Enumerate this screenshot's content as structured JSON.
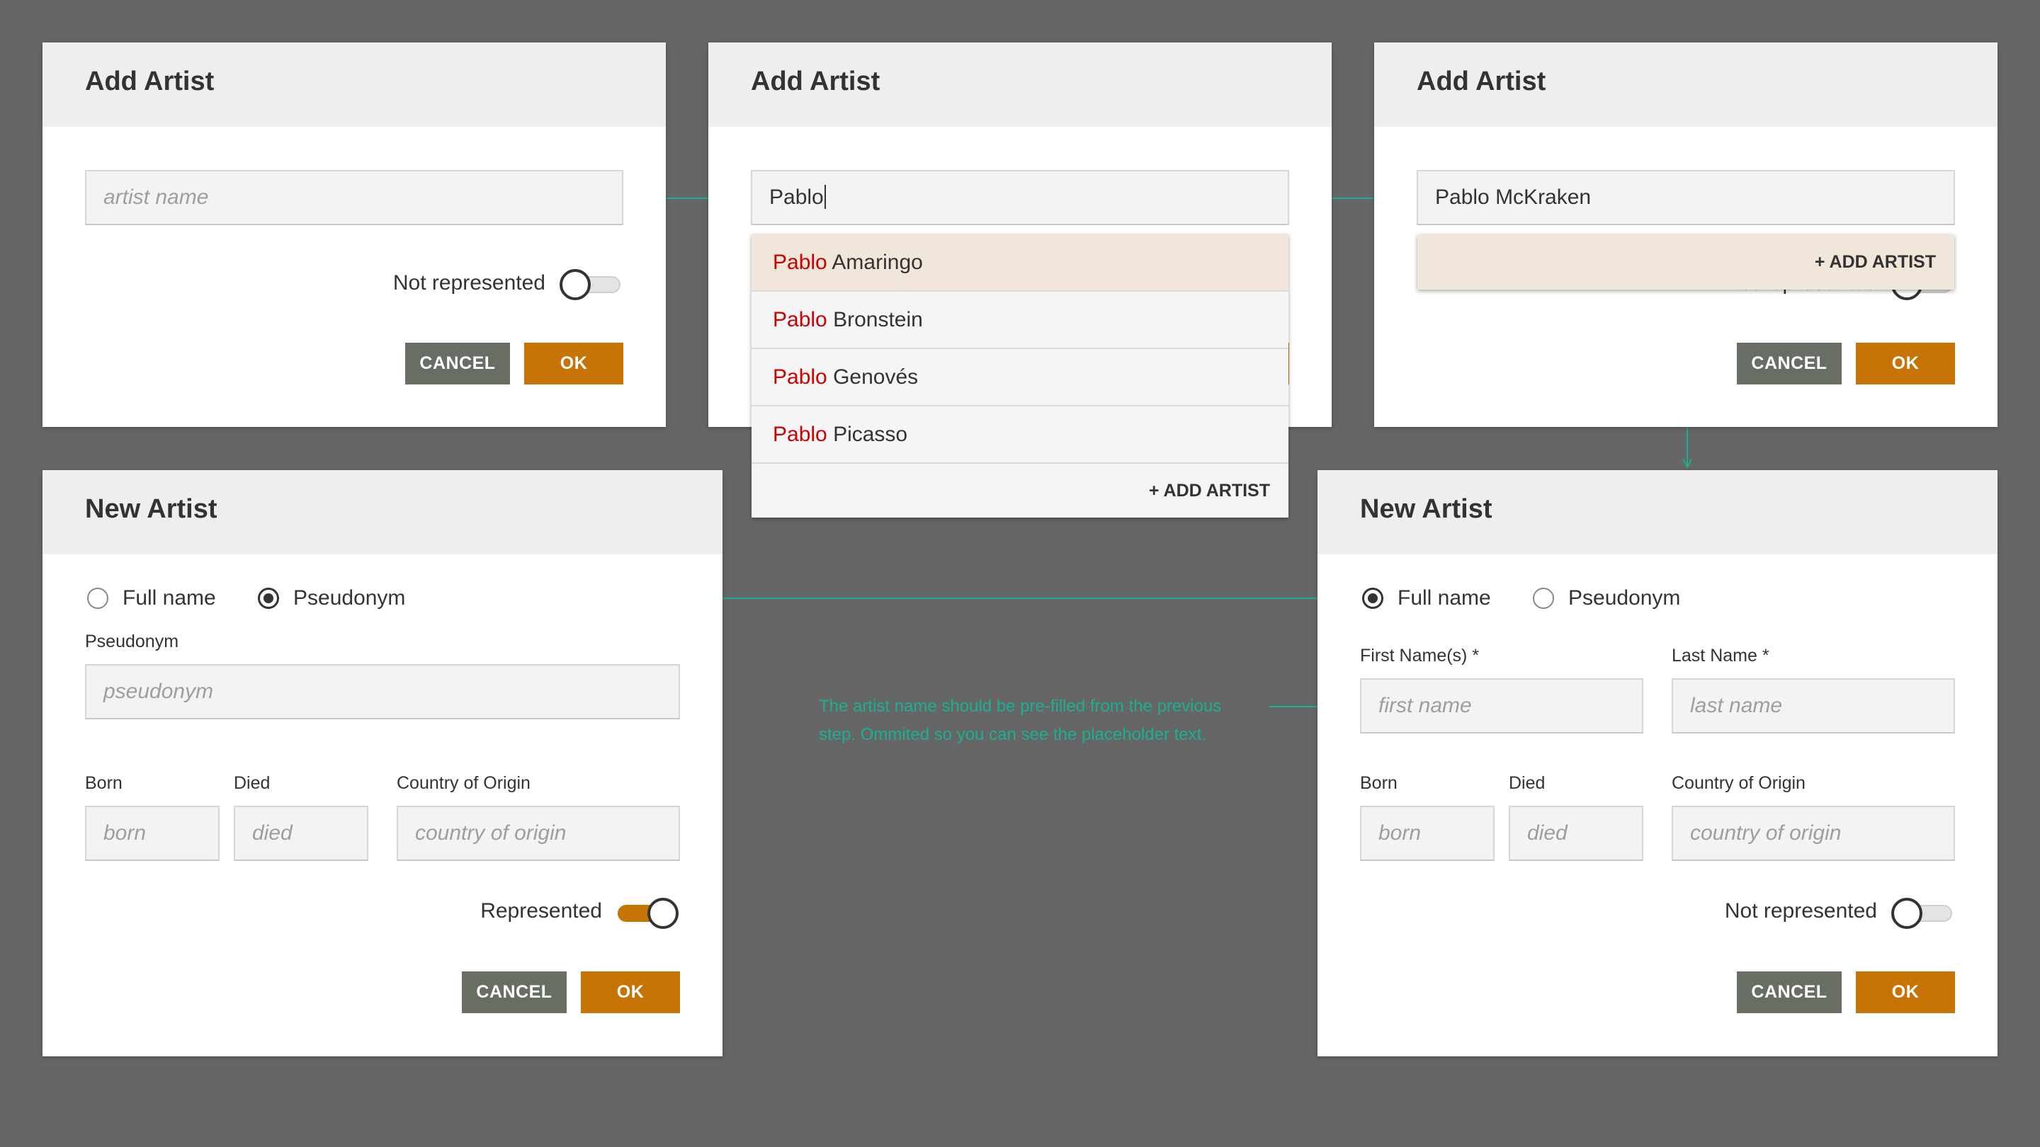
{
  "colors": {
    "background": "#666666",
    "accent": "#c77406",
    "cancel": "#686e63",
    "arrow": "#1aaf93",
    "match": "#cc0000",
    "highlight": "#f0e6da"
  },
  "panel1": {
    "title": "Add Artist",
    "artist_placeholder": "artist name",
    "toggle_label": "Not represented",
    "toggle_on": false,
    "cancel": "CANCEL",
    "ok": "OK"
  },
  "panel2": {
    "title": "Add Artist",
    "artist_value": "Pablo",
    "results": [
      {
        "match": "Pablo",
        "rest": " Amaringo",
        "highlighted": true
      },
      {
        "match": "Pablo",
        "rest": " Bronstein",
        "highlighted": false
      },
      {
        "match": "Pablo",
        "rest": " Genovés",
        "highlighted": false
      },
      {
        "match": "Pablo",
        "rest": " Picasso",
        "highlighted": false
      }
    ],
    "add_artist": "+ ADD ARTIST"
  },
  "panel3": {
    "title": "Add Artist",
    "artist_value": "Pablo McKraken",
    "add_artist": "+ ADD ARTIST",
    "toggle_label_partial": "Not represented",
    "cancel": "CANCEL",
    "ok": "OK"
  },
  "panel4": {
    "title": "New Artist",
    "radio_full": "Full name",
    "radio_pseudo": "Pseudonym",
    "selected": "Pseudonym",
    "pseudonym_label": "Pseudonym",
    "pseudonym_placeholder": "pseudonym",
    "born_label": "Born",
    "born_placeholder": "born",
    "died_label": "Died",
    "died_placeholder": "died",
    "country_label": "Country of Origin",
    "country_placeholder": "country of origin",
    "toggle_label": "Represented",
    "toggle_on": true,
    "cancel": "CANCEL",
    "ok": "OK"
  },
  "panel5": {
    "title": "New Artist",
    "radio_full": "Full name",
    "radio_pseudo": "Pseudonym",
    "selected": "Full name",
    "first_label": "First Name(s) *",
    "first_placeholder": "first name",
    "last_label": "Last Name *",
    "last_placeholder": "last name",
    "born_label": "Born",
    "born_placeholder": "born",
    "died_label": "Died",
    "died_placeholder": "died",
    "country_label": "Country of Origin",
    "country_placeholder": "country of origin",
    "toggle_label": "Not represented",
    "toggle_on": false,
    "cancel": "CANCEL",
    "ok": "OK"
  },
  "note": {
    "line1": "The artist name should be pre-filled from the previous",
    "line2": "step. Ommited so you can see the placeholder text."
  }
}
